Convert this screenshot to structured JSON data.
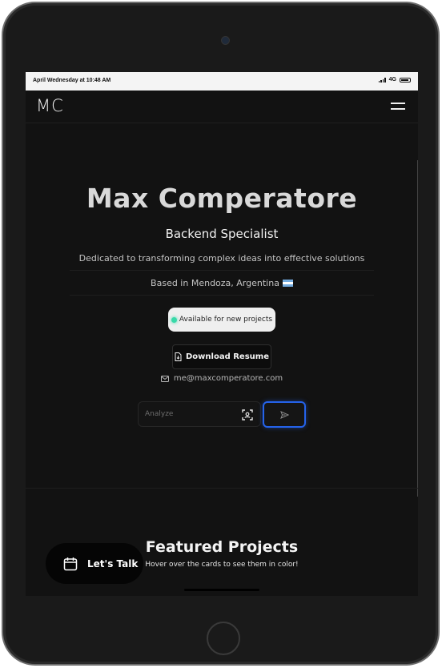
{
  "status_bar": {
    "time": "April Wednesday at 10:48 AM",
    "network": "4G"
  },
  "nav": {
    "logo": "MC"
  },
  "hero": {
    "name": "Max Comperatore",
    "role": "Backend Specialist",
    "tagline": "Dedicated to transforming complex ideas into effective solutions",
    "location": "Based in Mendoza, Argentina",
    "availability": "Available for new projects",
    "resume_label": "Download Resume",
    "email": "me@maxcomperatore.com"
  },
  "analyze": {
    "placeholder": "Analyze"
  },
  "featured": {
    "title": "Featured Projects",
    "subtitle": "Hover over the cards to see them in color!"
  },
  "cta": {
    "label": "Let's Talk"
  },
  "colors": {
    "accent_blue": "#2563eb",
    "status_green": "#38d9a9",
    "background": "#121212"
  },
  "icons": [
    "menu-icon",
    "argentina-flag-icon",
    "status-dot-icon",
    "document-icon",
    "mail-icon",
    "scan-icon",
    "send-icon",
    "calendar-icon"
  ]
}
